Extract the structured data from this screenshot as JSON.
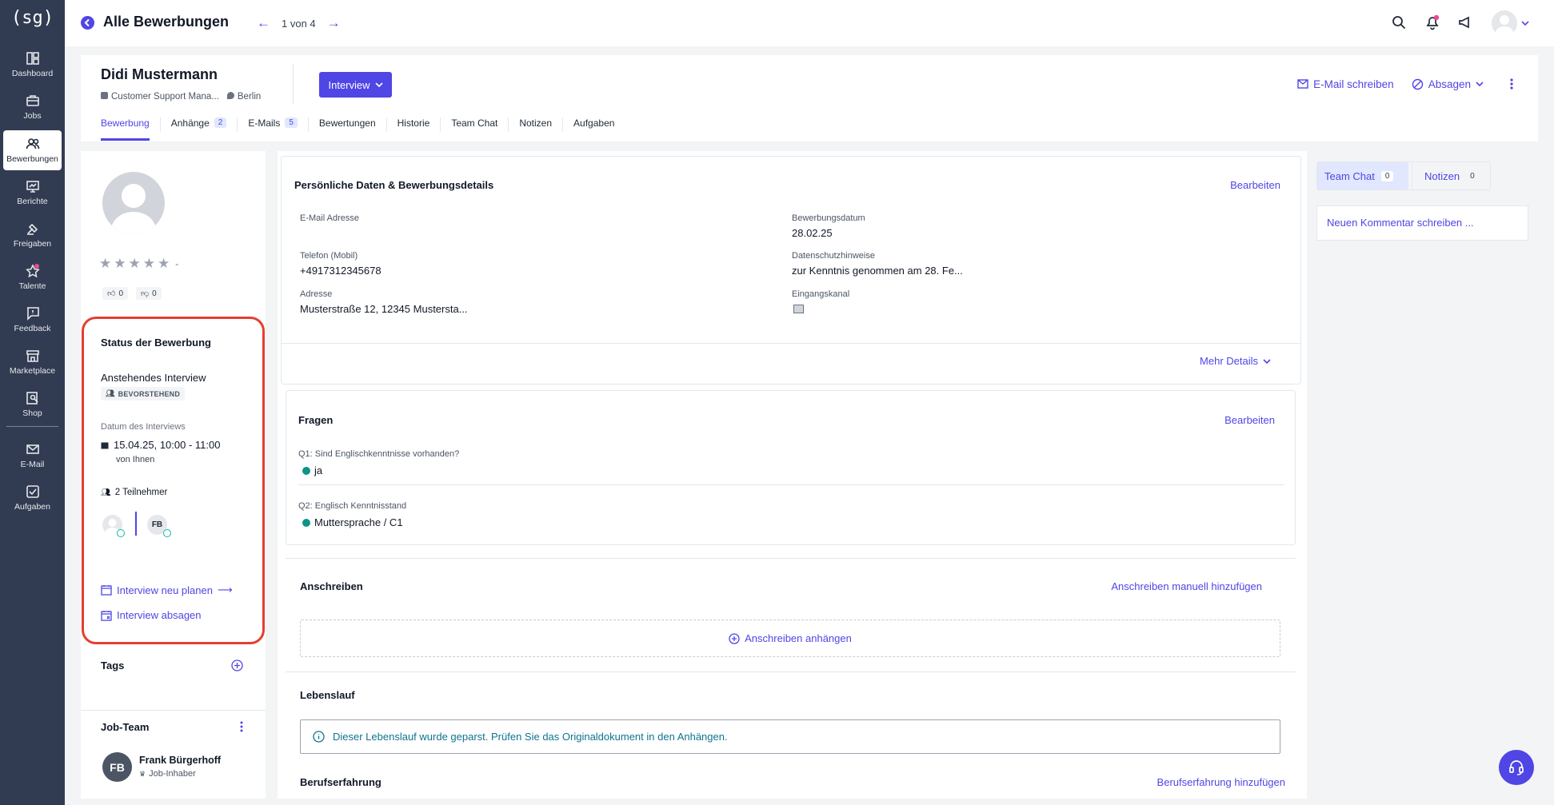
{
  "sidebar": {
    "logo": "(sg)",
    "items": [
      {
        "label": "Dashboard",
        "icon": "dashboard-icon"
      },
      {
        "label": "Jobs",
        "icon": "briefcase-icon"
      },
      {
        "label": "Bewerbungen",
        "icon": "users-icon"
      },
      {
        "label": "Berichte",
        "icon": "report-icon"
      },
      {
        "label": "Freigaben",
        "icon": "approval-icon"
      },
      {
        "label": "Talente",
        "icon": "star-icon"
      },
      {
        "label": "Feedback",
        "icon": "feedback-icon"
      },
      {
        "label": "Marketplace",
        "icon": "store-icon"
      },
      {
        "label": "Shop",
        "icon": "shop-icon"
      },
      {
        "label": "E-Mail",
        "icon": "mail-icon"
      },
      {
        "label": "Aufgaben",
        "icon": "tasks-icon"
      }
    ],
    "active": "Bewerbungen"
  },
  "topbar": {
    "title": "Alle Bewerbungen",
    "pager": "1 von 4"
  },
  "header": {
    "name": "Didi Mustermann",
    "job": "Customer Support Mana...",
    "location": "Berlin",
    "stage": "Interview",
    "email_action": "E-Mail schreiben",
    "reject_action": "Absagen",
    "tabs": [
      {
        "label": "Bewerbung",
        "badge": ""
      },
      {
        "label": "Anhänge",
        "badge": "2"
      },
      {
        "label": "E-Mails",
        "badge": "5"
      },
      {
        "label": "Bewertungen",
        "badge": ""
      },
      {
        "label": "Historie",
        "badge": ""
      },
      {
        "label": "Team Chat",
        "badge": ""
      },
      {
        "label": "Notizen",
        "badge": ""
      },
      {
        "label": "Aufgaben",
        "badge": ""
      }
    ]
  },
  "left": {
    "rating_dash": "-",
    "thumbs_up": "0",
    "thumbs_down": "0",
    "status_title": "Status der Bewerbung",
    "status_name": "Anstehendes Interview",
    "status_pill": "BEVORSTEHEND",
    "date_label": "Datum des Interviews",
    "date_value": "15.04.25, 10:00 - 11:00",
    "date_by": "von Ihnen",
    "participants": "2 Teilnehmer",
    "participant_initials": "FB",
    "reschedule": "Interview neu planen",
    "cancel": "Interview absagen",
    "tags_title": "Tags",
    "jobteam_title": "Job-Team",
    "member_initials": "FB",
    "member_name": "Frank Bürgerhoff",
    "member_role": "Job-Inhaber"
  },
  "personal": {
    "title": "Persönliche Daten & Bewerbungsdetails",
    "edit": "Bearbeiten",
    "email_label": "E-Mail Adresse",
    "phone_label": "Telefon (Mobil)",
    "phone": "+4917312345678",
    "address_label": "Adresse",
    "address": "Musterstraße 12, 12345 Mustersta...",
    "date_label": "Bewerbungsdatum",
    "date": "28.02.25",
    "privacy_label": "Datenschutzhinweise",
    "privacy": "zur Kenntnis genommen am 28. Fe...",
    "channel_label": "Eingangskanal",
    "more": "Mehr Details"
  },
  "questions": {
    "title": "Fragen",
    "edit": "Bearbeiten",
    "q1": "Q1: Sind Englischkenntnisse vorhanden?",
    "a1": "ja",
    "q2": "Q2: Englisch Kenntnisstand",
    "a2": "Muttersprache / C1"
  },
  "cover": {
    "title": "Anschreiben",
    "add_manual": "Anschreiben manuell hinzufügen",
    "attach": "Anschreiben anhängen"
  },
  "cv": {
    "title": "Lebenslauf",
    "info": "Dieser Lebenslauf wurde geparst. Prüfen Sie das Originaldokument in den Anhängen."
  },
  "experience": {
    "title": "Berufserfahrung",
    "add": "Berufserfahrung hinzufügen"
  },
  "right": {
    "team_chat": "Team Chat",
    "team_chat_count": "0",
    "notes": "Notizen",
    "notes_count": "0",
    "comment_placeholder": "Neuen Kommentar schreiben ..."
  },
  "colors": {
    "accent": "#4f46e5",
    "sidebar": "#313c52",
    "highlight": "#e53e30"
  }
}
